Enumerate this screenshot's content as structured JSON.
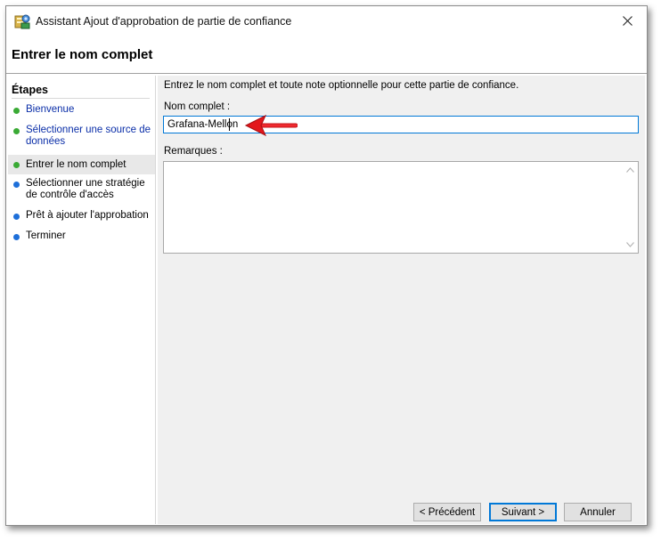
{
  "window": {
    "title": "Assistant Ajout d'approbation de partie de confiance",
    "close_glyph": "✕"
  },
  "header": {
    "title": "Entrer le nom complet"
  },
  "steps": {
    "title": "Étapes",
    "items": [
      {
        "label": "Bienvenue",
        "state": "done"
      },
      {
        "label": "Sélectionner une source de données",
        "state": "done"
      },
      {
        "label": "Entrer le nom complet",
        "state": "current"
      },
      {
        "label": "Sélectionner une stratégie de contrôle d'accès",
        "state": "pending"
      },
      {
        "label": "Prêt à ajouter l'approbation",
        "state": "pending"
      },
      {
        "label": "Terminer",
        "state": "pending"
      }
    ]
  },
  "main": {
    "description": "Entrez le nom complet et toute note optionnelle pour cette partie de confiance.",
    "name_label": "Nom complet :",
    "name_value": "Grafana-Mellon",
    "notes_label": "Remarques :",
    "notes_value": ""
  },
  "buttons": {
    "previous": "< Précédent",
    "next": "Suivant >",
    "cancel": "Annuler"
  },
  "icons": {
    "app": "adfs-wizard-icon",
    "close": "close-icon",
    "arrow": "red-arrow-annotation",
    "scroll_up": "chevron-up-icon",
    "scroll_down": "chevron-down-icon"
  },
  "colors": {
    "done_dot": "#3aaa35",
    "pending_dot": "#1e6fd9",
    "link_text": "#0a2ea8",
    "focus_border": "#0078d7",
    "annotation_arrow": "#e3161b"
  }
}
